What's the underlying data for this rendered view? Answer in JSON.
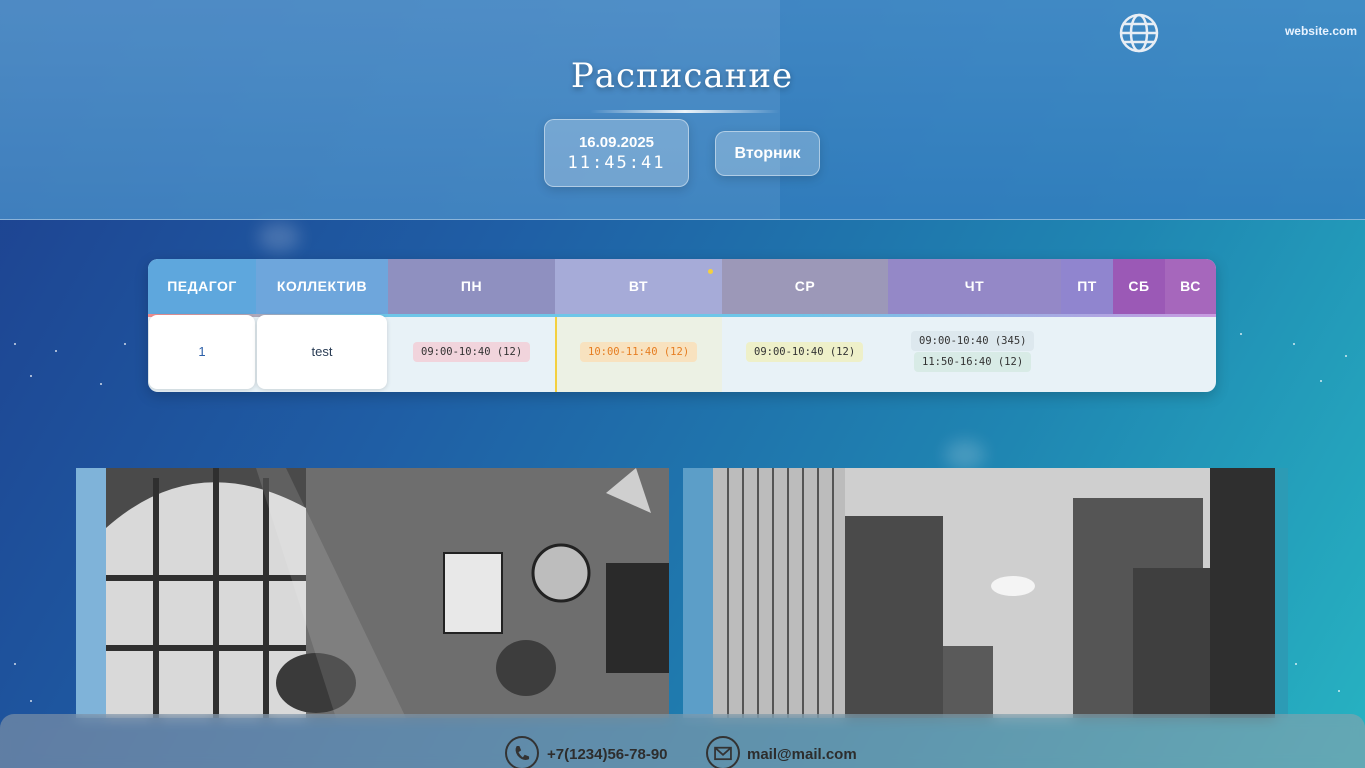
{
  "header": {
    "site": "website.com",
    "title": "Расписание",
    "date": "16.09.2025",
    "time": "11:45:41",
    "day_button": "Вторник"
  },
  "table": {
    "columns": [
      "ПЕДАГОГ",
      "КОЛЛЕКТИВ",
      "ПН",
      "ВТ",
      "СР",
      "ЧТ",
      "ПТ",
      "СБ",
      "ВС"
    ],
    "row": {
      "teacher": "1",
      "group": "test",
      "mon": [
        "09:00-10:40 (12)"
      ],
      "tue": [
        "10:00-11:40 (12)"
      ],
      "wed": [
        "09:00-10:40 (12)"
      ],
      "thu": [
        "09:00-10:40 (345)",
        "11:50-16:40 (12)"
      ]
    }
  },
  "footer": {
    "phone": "+7(1234)56-78-90",
    "email": "mail@mail.com"
  },
  "colors": {
    "accent_today": "#f4d03f",
    "header_pedagog": "#5ea7dd",
    "header_sat": "#9b59b6"
  }
}
